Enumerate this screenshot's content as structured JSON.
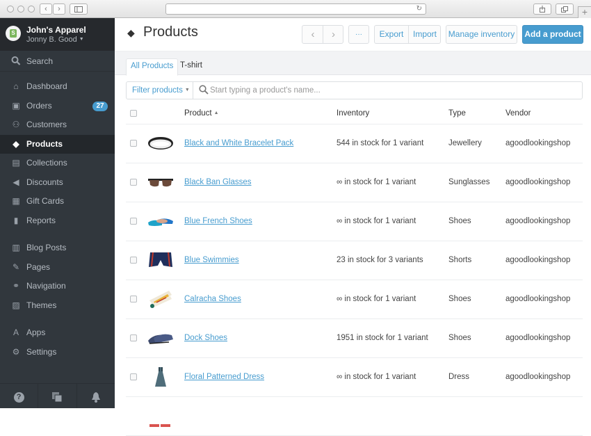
{
  "browser": {
    "back_icon": "chevron-left-icon",
    "forward_icon": "chevron-right-icon",
    "sidebar_toggle_icon": "sidebar-icon",
    "reload_icon": "reload-icon",
    "share_icon": "share-icon",
    "tabs_icon": "tabs-icon",
    "new_tab_label": "+"
  },
  "store": {
    "name": "John's Apparel",
    "user": "Jonny B. Good"
  },
  "sidebar": {
    "search_label": "Search",
    "items": [
      {
        "label": "Dashboard",
        "icon": "home-icon"
      },
      {
        "label": "Orders",
        "icon": "inbox-icon",
        "badge": "27"
      },
      {
        "label": "Customers",
        "icon": "customers-icon"
      },
      {
        "label": "Products",
        "icon": "tag-icon",
        "active": true
      },
      {
        "label": "Collections",
        "icon": "collections-icon"
      },
      {
        "label": "Discounts",
        "icon": "megaphone-icon"
      },
      {
        "label": "Gift Cards",
        "icon": "gift-icon"
      },
      {
        "label": "Reports",
        "icon": "bar-chart-icon"
      },
      {
        "label": "Blog Posts",
        "icon": "newspaper-icon"
      },
      {
        "label": "Pages",
        "icon": "edit-page-icon"
      },
      {
        "label": "Navigation",
        "icon": "link-icon"
      },
      {
        "label": "Themes",
        "icon": "image-icon"
      },
      {
        "label": "Apps",
        "icon": "apps-icon"
      },
      {
        "label": "Settings",
        "icon": "gear-icon"
      }
    ],
    "footer": {
      "help_label": "?",
      "help_icon": "help-icon",
      "stack_icon": "stack-icon",
      "bell_icon": "bell-icon"
    }
  },
  "header": {
    "title": "Products",
    "prev_label": "‹",
    "next_label": "›",
    "more_label": "···",
    "export_label": "Export",
    "import_label": "Import",
    "manage_inventory_label": "Manage inventory",
    "add_product_label": "Add a product"
  },
  "tabs": [
    {
      "label": "All Products",
      "active": true
    },
    {
      "label": "T-shirt",
      "active": false
    }
  ],
  "filter": {
    "button_label": "Filter products",
    "search_placeholder": "Start typing a product's name..."
  },
  "table": {
    "columns": {
      "product": "Product",
      "inventory": "Inventory",
      "type": "Type",
      "vendor": "Vendor"
    },
    "rows": [
      {
        "name": "Black and White Bracelet Pack",
        "inventory": "544 in stock for 1 variant",
        "type": "Jewellery",
        "vendor": "agoodlookingshop",
        "thumb": "bracelet"
      },
      {
        "name": "Black Ban Glasses",
        "inventory": "∞ in stock for 1 variant",
        "type": "Sunglasses",
        "vendor": "agoodlookingshop",
        "thumb": "glasses"
      },
      {
        "name": "Blue French Shoes",
        "inventory": "∞ in stock for 1 variant",
        "type": "Shoes",
        "vendor": "agoodlookingshop",
        "thumb": "blue-shoes"
      },
      {
        "name": "Blue Swimmies",
        "inventory": "23 in stock for 3 variants",
        "type": "Shorts",
        "vendor": "agoodlookingshop",
        "thumb": "swim-shorts"
      },
      {
        "name": "Calracha Shoes",
        "inventory": "∞ in stock for 1 variant",
        "type": "Shoes",
        "vendor": "agoodlookingshop",
        "thumb": "calracha-shoes"
      },
      {
        "name": "Dock Shoes",
        "inventory": "1951 in stock for 1 variant",
        "type": "Shoes",
        "vendor": "agoodlookingshop",
        "thumb": "dock-shoes"
      },
      {
        "name": "Floral Patterned Dress",
        "inventory": "∞ in stock for 1 variant",
        "type": "Dress",
        "vendor": "agoodlookingshop",
        "thumb": "dress"
      }
    ]
  },
  "colors": {
    "accent": "#479ccf",
    "sidebar_bg": "#31373d",
    "sidebar_header_bg": "#26292d",
    "sidebar_active_bg": "#23272b"
  }
}
